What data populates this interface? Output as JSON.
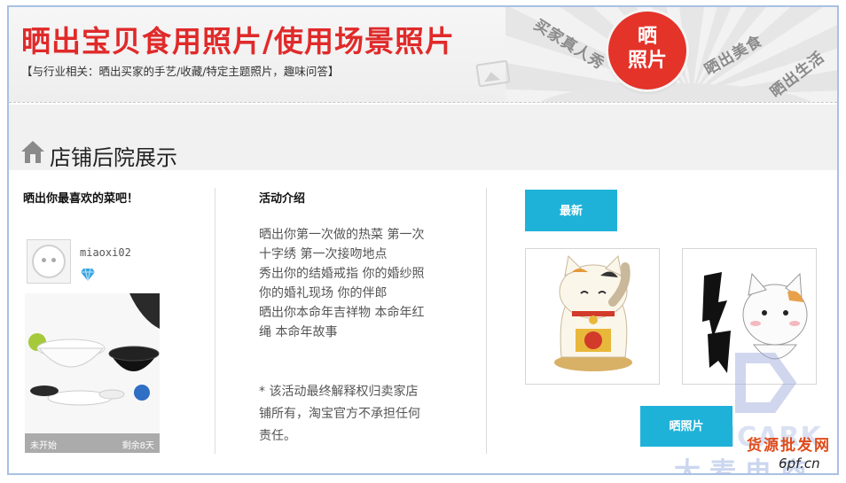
{
  "banner": {
    "title": "晒出宝贝食用照片/使用场景照片",
    "subtitle": "【与行业相关：晒出买家的手艺/收藏/特定主题照片，趣味问答】",
    "tags": [
      "买家真人秀",
      "晒出美食",
      "晒出生活"
    ],
    "badge_line1": "晒",
    "badge_line2": "照片"
  },
  "section": {
    "title": "店铺后院展示"
  },
  "left": {
    "title": "晒出你最喜欢的菜吧！",
    "username": "miaoxi02",
    "photo_status_left": "未开始",
    "photo_status_right": "剩余8天"
  },
  "activity": {
    "title": "活动介绍",
    "lines": [
      "晒出你第一次做的热菜 第一次",
      "十字绣 第一次接吻地点",
      "秀出你的结婚戒指 你的婚纱照",
      "你的婚礼现场 你的伴郎",
      "晒出你本命年吉祥物 本命年红",
      "绳 本命年故事"
    ],
    "note_lines": [
      "* 该活动最终解释权归卖家店",
      "铺所有，淘宝官方不承担任何",
      "责任。"
    ]
  },
  "right": {
    "newest_label": "最新",
    "share_label": "晒照片"
  },
  "watermark": {
    "logo_text": "D·MCARK",
    "cn_text": "大麦电商",
    "site_text": "货源批发网",
    "url": "6pf.cn"
  },
  "colors": {
    "accent_red": "#e02a2a",
    "button_blue": "#1fb2d9",
    "frame_border": "#a9c0e3"
  }
}
